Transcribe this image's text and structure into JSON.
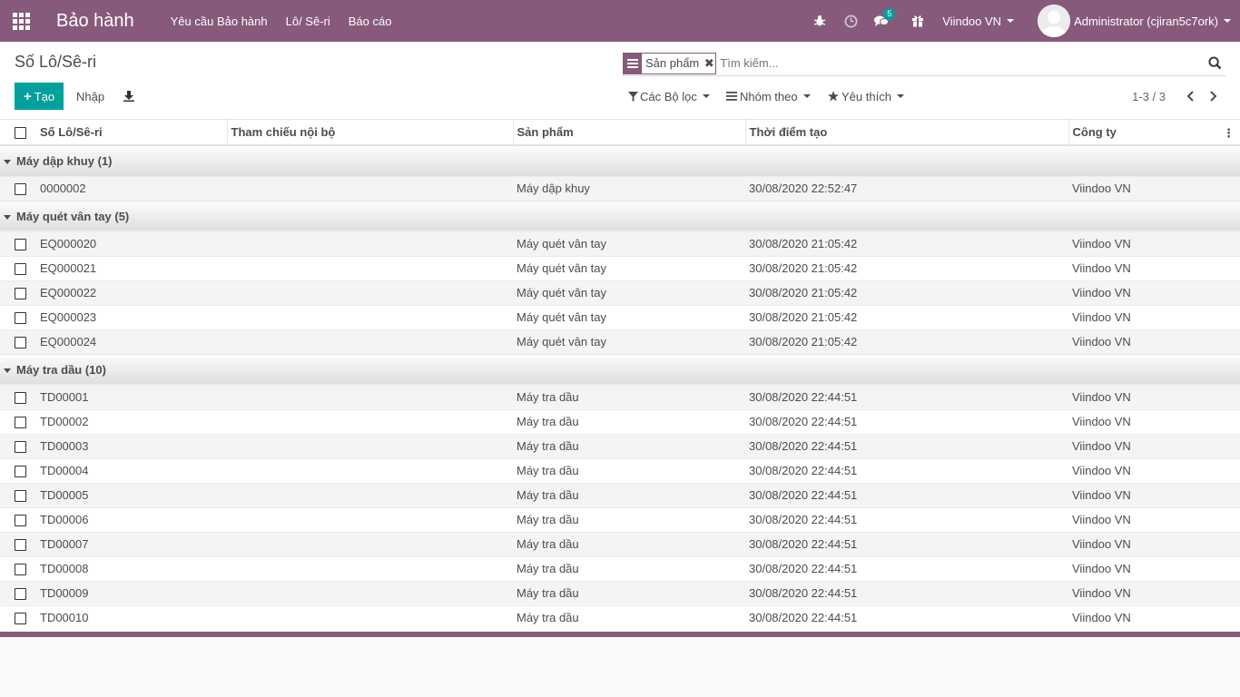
{
  "navbar": {
    "app_title": "Bảo hành",
    "menu": [
      "Yêu cầu Bảo hành",
      "Lô/ Sê-ri",
      "Báo cáo"
    ],
    "message_count": "5",
    "company": "Viindoo VN",
    "user": "Administrator (cjiran5c7ork)"
  },
  "control_panel": {
    "breadcrumb": "Số Lô/Sê-ri",
    "facet_value": "Sản phẩm",
    "search_placeholder": "Tìm kiếm...",
    "create_label": "Tạo",
    "import_label": "Nhập",
    "filters_label": "Các Bộ lọc",
    "groupby_label": "Nhóm theo",
    "favorites_label": "Yêu thích",
    "pager_value": "1-3 / 3"
  },
  "table": {
    "columns": [
      "Số Lô/Sê-ri",
      "Tham chiếu nội bộ",
      "Sản phẩm",
      "Thời điểm tạo",
      "Công ty"
    ],
    "groups": [
      {
        "label": "Máy dập khuy (1)",
        "rows": [
          {
            "lot": "0000002",
            "ref": "",
            "product": "Máy dập khuy",
            "date": "30/08/2020 22:52:47",
            "company": "Viindoo VN"
          }
        ]
      },
      {
        "label": "Máy quét vân tay (5)",
        "rows": [
          {
            "lot": "EQ000020",
            "ref": "",
            "product": "Máy quét vân tay",
            "date": "30/08/2020 21:05:42",
            "company": "Viindoo VN"
          },
          {
            "lot": "EQ000021",
            "ref": "",
            "product": "Máy quét vân tay",
            "date": "30/08/2020 21:05:42",
            "company": "Viindoo VN"
          },
          {
            "lot": "EQ000022",
            "ref": "",
            "product": "Máy quét vân tay",
            "date": "30/08/2020 21:05:42",
            "company": "Viindoo VN"
          },
          {
            "lot": "EQ000023",
            "ref": "",
            "product": "Máy quét vân tay",
            "date": "30/08/2020 21:05:42",
            "company": "Viindoo VN"
          },
          {
            "lot": "EQ000024",
            "ref": "",
            "product": "Máy quét vân tay",
            "date": "30/08/2020 21:05:42",
            "company": "Viindoo VN"
          }
        ]
      },
      {
        "label": "Máy tra dầu (10)",
        "rows": [
          {
            "lot": "TD00001",
            "ref": "",
            "product": "Máy tra dầu",
            "date": "30/08/2020 22:44:51",
            "company": "Viindoo VN"
          },
          {
            "lot": "TD00002",
            "ref": "",
            "product": "Máy tra dầu",
            "date": "30/08/2020 22:44:51",
            "company": "Viindoo VN"
          },
          {
            "lot": "TD00003",
            "ref": "",
            "product": "Máy tra dầu",
            "date": "30/08/2020 22:44:51",
            "company": "Viindoo VN"
          },
          {
            "lot": "TD00004",
            "ref": "",
            "product": "Máy tra dầu",
            "date": "30/08/2020 22:44:51",
            "company": "Viindoo VN"
          },
          {
            "lot": "TD00005",
            "ref": "",
            "product": "Máy tra dầu",
            "date": "30/08/2020 22:44:51",
            "company": "Viindoo VN"
          },
          {
            "lot": "TD00006",
            "ref": "",
            "product": "Máy tra dầu",
            "date": "30/08/2020 22:44:51",
            "company": "Viindoo VN"
          },
          {
            "lot": "TD00007",
            "ref": "",
            "product": "Máy tra dầu",
            "date": "30/08/2020 22:44:51",
            "company": "Viindoo VN"
          },
          {
            "lot": "TD00008",
            "ref": "",
            "product": "Máy tra dầu",
            "date": "30/08/2020 22:44:51",
            "company": "Viindoo VN"
          },
          {
            "lot": "TD00009",
            "ref": "",
            "product": "Máy tra dầu",
            "date": "30/08/2020 22:44:51",
            "company": "Viindoo VN"
          },
          {
            "lot": "TD00010",
            "ref": "",
            "product": "Máy tra dầu",
            "date": "30/08/2020 22:44:51",
            "company": "Viindoo VN"
          }
        ]
      }
    ]
  },
  "icons": {
    "apps": "apps-grid-icon",
    "bug": "bug-icon",
    "activity": "clock-icon",
    "messages": "chat-icon",
    "gift": "gift-icon",
    "search": "search-icon",
    "download": "download-icon",
    "filter": "filter-icon",
    "groupby": "list-icon",
    "favorite": "star-icon"
  },
  "colors": {
    "brand": "#875a7b",
    "primary": "#00a09d"
  }
}
